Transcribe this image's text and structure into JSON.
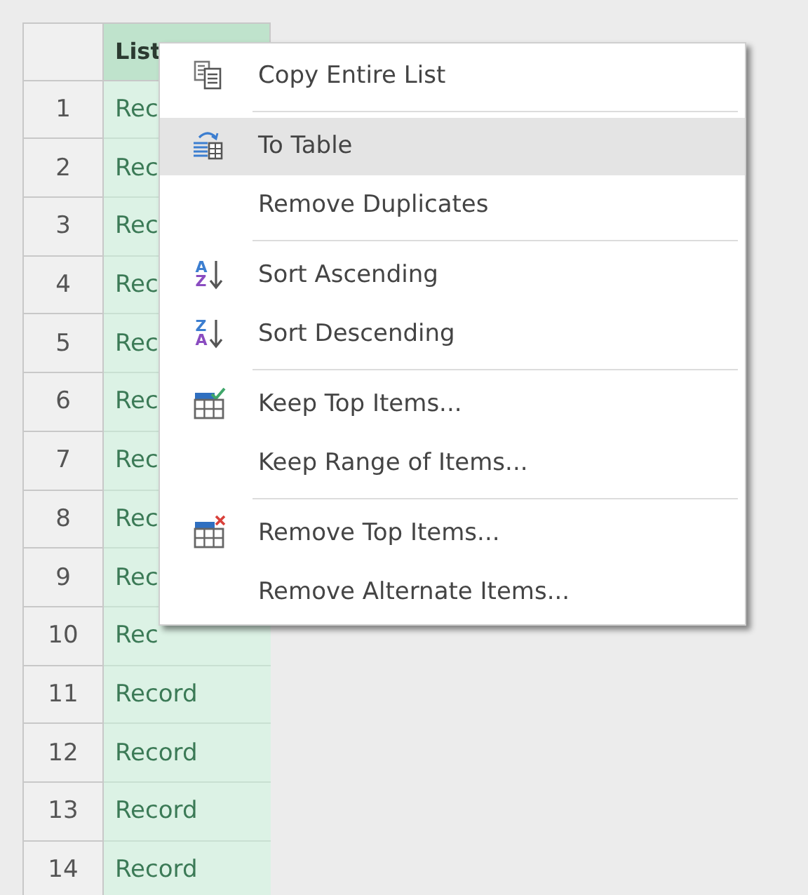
{
  "table": {
    "columns": [
      {
        "label": "List",
        "selected": true
      }
    ],
    "rows": [
      {
        "number": "1",
        "value": "Rec"
      },
      {
        "number": "2",
        "value": "Rec"
      },
      {
        "number": "3",
        "value": "Rec"
      },
      {
        "number": "4",
        "value": "Rec"
      },
      {
        "number": "5",
        "value": "Rec"
      },
      {
        "number": "6",
        "value": "Rec"
      },
      {
        "number": "7",
        "value": "Rec"
      },
      {
        "number": "8",
        "value": "Rec"
      },
      {
        "number": "9",
        "value": "Rec"
      },
      {
        "number": "10",
        "value": "Rec"
      },
      {
        "number": "11",
        "value": "Record"
      },
      {
        "number": "12",
        "value": "Record"
      },
      {
        "number": "13",
        "value": "Record"
      },
      {
        "number": "14",
        "value": "Record"
      }
    ]
  },
  "context_menu": {
    "groups": [
      [
        {
          "label": "Copy Entire List",
          "kind": "copy",
          "selected": false
        }
      ],
      [
        {
          "label": "To Table",
          "kind": "convert",
          "selected": true
        },
        {
          "label": "Remove Duplicates",
          "kind": "plain",
          "selected": false
        }
      ],
      [
        {
          "label": "Sort Ascending",
          "kind": "sort",
          "glyphs": [
            "A",
            "Z"
          ],
          "selected": false
        },
        {
          "label": "Sort Descending",
          "kind": "sort",
          "glyphs": [
            "Z",
            "A"
          ],
          "selected": false
        }
      ],
      [
        {
          "label": "Keep Top Items...",
          "kind": "keep",
          "selected": false
        },
        {
          "label": "Keep Range of Items...",
          "kind": "plain",
          "selected": false
        }
      ],
      [
        {
          "label": "Remove Top Items...",
          "kind": "remove",
          "selected": false
        },
        {
          "label": "Remove Alternate Items...",
          "kind": "plain",
          "selected": false
        }
      ]
    ]
  }
}
